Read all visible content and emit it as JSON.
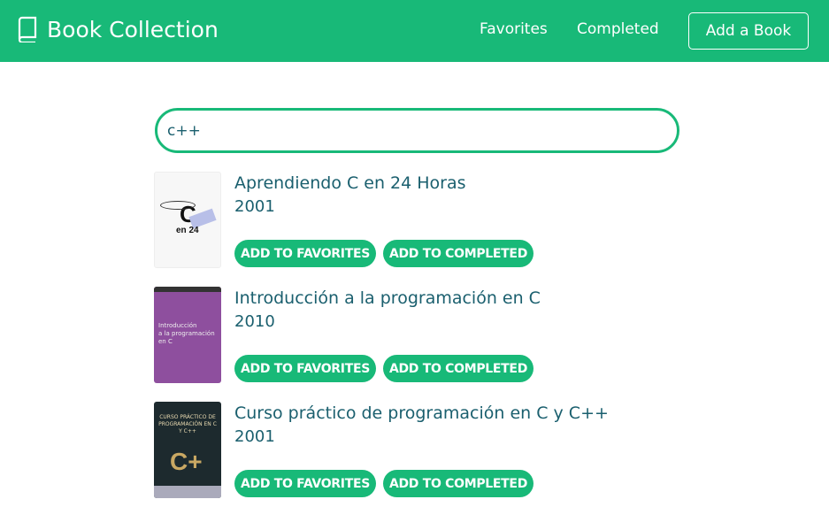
{
  "header": {
    "title": "Book Collection",
    "icon": "book-icon",
    "nav": [
      "Favorites",
      "Completed"
    ],
    "add_button": "Add a Book"
  },
  "search": {
    "value": "c++",
    "placeholder": ""
  },
  "books": [
    {
      "title": "Aprendiendo C en 24 Horas",
      "year": "2001",
      "fav": "ADD TO FAVORITES",
      "comp": "ADD TO COMPLETED"
    },
    {
      "title": "Introducción a la programación en C",
      "year": "2010",
      "fav": "ADD TO FAVORITES",
      "comp": "ADD TO COMPLETED"
    },
    {
      "title": "Curso práctico de programación en C y C++",
      "year": "2001",
      "fav": "ADD TO FAVORITES",
      "comp": "ADD TO COMPLETED"
    }
  ],
  "colors": {
    "accent": "#18b978",
    "text": "#1a5f6e"
  }
}
